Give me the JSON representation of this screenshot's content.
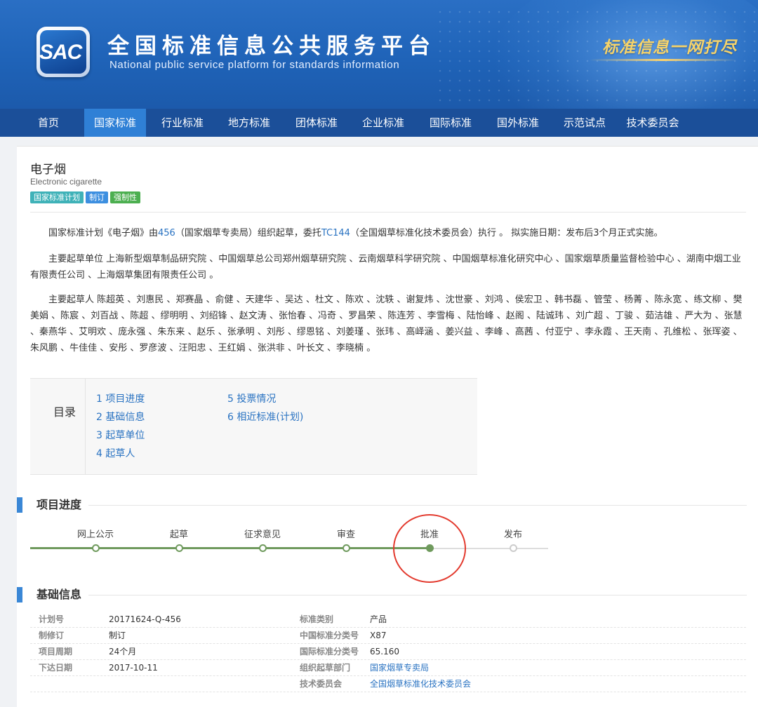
{
  "site": {
    "logo_text": "SAC",
    "title": "全国标准信息公共服务平台",
    "subtitle": "National public service platform  for standards information",
    "slogan": "标准信息一网打尽"
  },
  "nav": [
    "首页",
    "国家标准",
    "行业标准",
    "地方标准",
    "团体标准",
    "企业标准",
    "国际标准",
    "国外标准",
    "示范试点",
    "技术委员会"
  ],
  "nav_active": "国家标准",
  "standard": {
    "title": "电子烟",
    "title_en": "Electronic cigarette",
    "tags": [
      {
        "label": "国家标准计划",
        "color": "#3fb2b8"
      },
      {
        "label": "制订",
        "color": "#3d8fe0"
      },
      {
        "label": "强制性",
        "color": "#4caf50"
      }
    ]
  },
  "intro": {
    "p1_a": "国家标准计划《电子烟》由",
    "p1_link1": "456",
    "p1_b": "（国家烟草专卖局）组织起草，委托",
    "p1_link2": "TC144",
    "p1_c": "（全国烟草标准化技术委员会）执行 。 拟实施日期：发布后3个月正式实施。",
    "p2": "主要起草单位 上海新型烟草制品研究院 、中国烟草总公司郑州烟草研究院 、云南烟草科学研究院 、中国烟草标准化研究中心 、国家烟草质量监督检验中心 、湖南中烟工业有限责任公司 、上海烟草集团有限责任公司 。",
    "p3": "主要起草人 陈超英 、刘惠民 、郑赛晶 、俞健 、天建华 、吴达 、杜文 、陈欢 、沈轶 、谢复炜 、沈世豪 、刘鸿 、侯宏卫 、韩书磊 、管莹 、杨菁 、陈永宽 、练文柳 、樊美娟 、陈宸 、刘百战 、陈超 、缪明明 、刘绍锋 、赵文涛 、张怡春 、冯奇 、罗昌荣 、陈连芳 、李雪梅 、陆怡峰 、赵阁 、陆诚玮 、刘广超 、丁骏 、茹洁雄 、严大为 、张慧 、秦燕华 、艾明欢 、庞永强 、朱东来 、赵乐 、张承明 、刘彤 、缪恩铭 、刘姜瑾 、张玮 、高峄涵 、姜兴益 、李峰 、高茜 、付亚宁 、李永霞 、王天南 、孔维松 、张珲姿 、朱风鹏 、牛佳佳 、安彤 、罗彦波 、汪阳忠 、王红娟 、张洪非 、叶长文 、李晓楠 。"
  },
  "toc": {
    "label": "目录",
    "col1": [
      "1 项目进度",
      "2 基础信息",
      "3 起草单位",
      "4 起草人"
    ],
    "col2": [
      "5 投票情况",
      "6 相近标准(计划)"
    ]
  },
  "progress": {
    "heading": "项目进度",
    "steps": [
      "网上公示",
      "起草",
      "征求意见",
      "审查",
      "批准",
      "发布"
    ],
    "current_step": 5
  },
  "basic": {
    "heading": "基础信息",
    "rows": [
      {
        "k1": "计划号",
        "v1": "20171624-Q-456",
        "k2": "标准类别",
        "v2": "产品",
        "v2_link": false
      },
      {
        "k1": "制修订",
        "v1": "制订",
        "k2": "中国标准分类号",
        "v2": "X87",
        "v2_link": false
      },
      {
        "k1": "项目周期",
        "v1": "24个月",
        "k2": "国际标准分类号",
        "v2": "65.160",
        "v2_link": false
      },
      {
        "k1": "下达日期",
        "v1": "2017-10-11",
        "k2": "组织起草部门",
        "v2": "国家烟草专卖局",
        "v2_link": true
      },
      {
        "k1": "",
        "v1": "",
        "k2": "技术委员会",
        "v2": "全国烟草标准化技术委员会",
        "v2_link": true
      }
    ]
  }
}
